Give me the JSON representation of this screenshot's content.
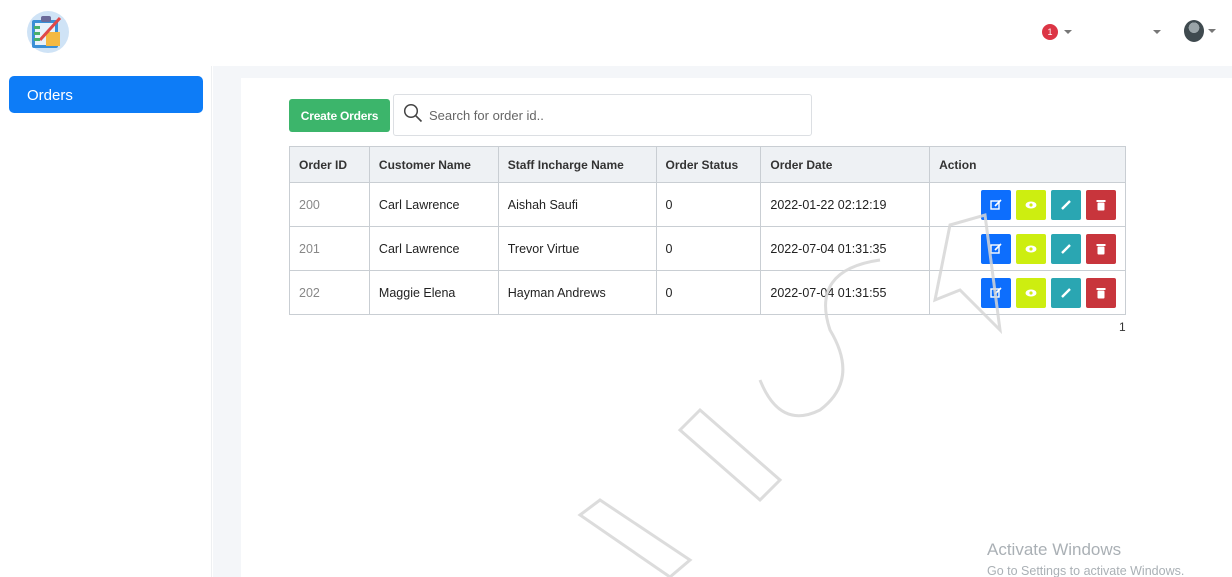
{
  "header": {
    "notification_count": "1"
  },
  "sidebar": {
    "items": [
      {
        "label": "Orders"
      }
    ]
  },
  "toolbar": {
    "create_label": "Create Orders",
    "search_placeholder": "Search for order id.."
  },
  "table": {
    "columns": [
      "Order ID",
      "Customer Name",
      "Staff Incharge Name",
      "Order Status",
      "Order Date",
      "Action"
    ],
    "rows": [
      {
        "id": "200",
        "customer": "Carl Lawrence",
        "staff": "Aishah Saufi",
        "status": "0",
        "date": "2022-01-22 02:12:19"
      },
      {
        "id": "201",
        "customer": "Carl Lawrence",
        "staff": "Trevor Virtue",
        "status": "0",
        "date": "2022-07-04 01:31:35"
      },
      {
        "id": "202",
        "customer": "Maggie Elena",
        "staff": "Hayman Andrews",
        "status": "0",
        "date": "2022-07-04 01:31:55"
      }
    ]
  },
  "pagination": {
    "page": "1"
  },
  "activation": {
    "title": "Activate Windows",
    "subtitle": "Go to Settings to activate Windows."
  },
  "colors": {
    "primary": "#0d7cf7",
    "create_button": "#3cb56b",
    "action_edit_square": "#0d6efd",
    "action_view": "#cdee10",
    "action_edit": "#2aa6b2",
    "action_delete": "#c8353c"
  },
  "icons": [
    "app-logo-icon",
    "notification-icon",
    "user-avatar-icon",
    "search-icon",
    "edit-square-icon",
    "eye-icon",
    "pencil-icon",
    "trash-icon"
  ]
}
